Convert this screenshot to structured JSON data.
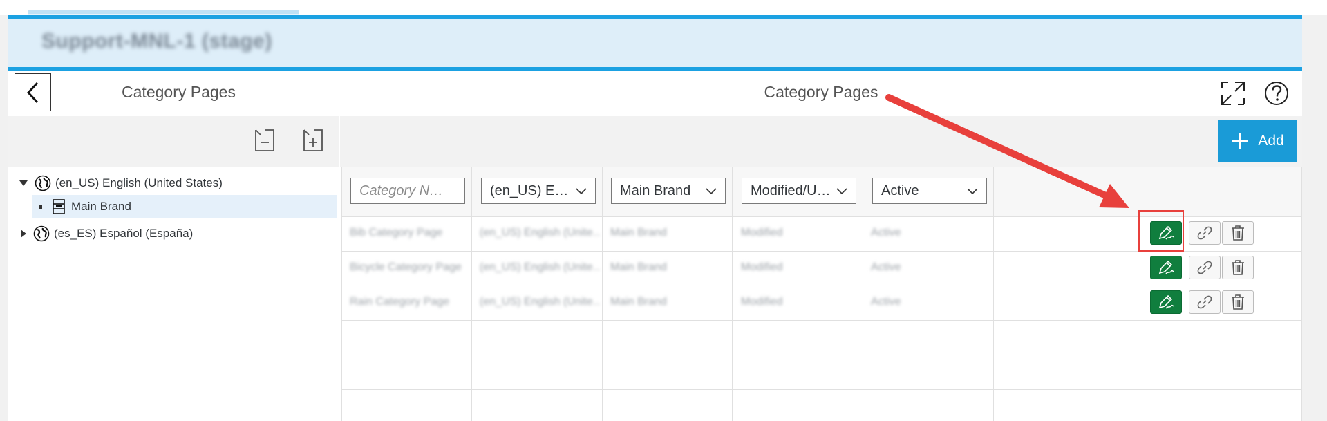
{
  "header": {
    "title": "Support-MNL-1 (stage)"
  },
  "left_panel": {
    "title": "Category Pages",
    "tree": [
      {
        "label": "(en_US) English (United States)",
        "expanded": true
      },
      {
        "label": "Main Brand",
        "selected": true
      },
      {
        "label": "(es_ES) Español (España)",
        "expanded": false
      }
    ]
  },
  "right_panel": {
    "title": "Category Pages",
    "add_label": "Add",
    "filters": {
      "name_placeholder": "Category N…",
      "locale": "(en_US) E…",
      "brand": "Main Brand",
      "status": "Modified/U…",
      "active": "Active"
    },
    "rows": [
      {
        "name": "Bib Category Page",
        "locale": "(en_US) English (Unite…",
        "brand": "Main Brand",
        "status": "Modified",
        "active": "Active"
      },
      {
        "name": "Bicycle Category Page",
        "locale": "(en_US) English (Unite…",
        "brand": "Main Brand",
        "status": "Modified",
        "active": "Active"
      },
      {
        "name": "Rain Category Page",
        "locale": "(en_US) English (Unite…",
        "brand": "Main Brand",
        "status": "Modified",
        "active": "Active"
      }
    ]
  },
  "colors": {
    "accent": "#1ba1e2",
    "header_bg": "#deeef9",
    "add_button": "#1a9bd7",
    "edit_button": "#107e3e",
    "annotation": "#e8403c"
  }
}
